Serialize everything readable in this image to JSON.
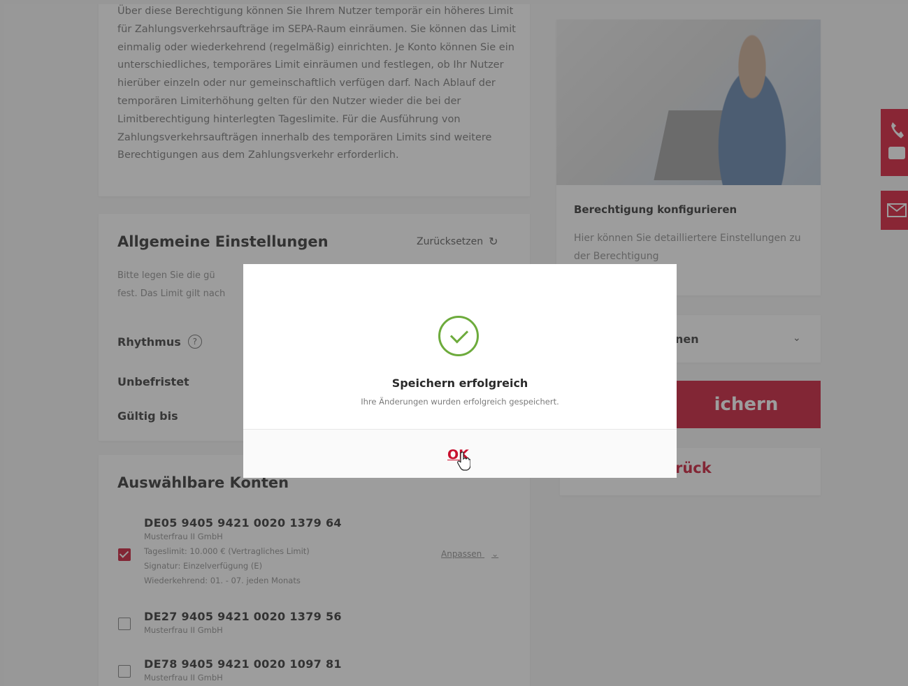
{
  "intro": {
    "text": "Über diese Berechtigung können Sie Ihrem Nutzer temporär ein höheres Limit für Zahlungsverkehrsaufträge im SEPA-Raum einräumen. Sie können das Limit einmalig oder wiederkehrend (regelmäßig) einrichten. Je Konto können Sie ein unterschiedliches, temporäres Limit einräumen und festlegen, ob Ihr Nutzer hierüber einzeln oder nur gemeinschaftlich verfügen darf. Nach Ablauf der temporären Limiterhöhung gelten für den Nutzer wieder die bei der Limitberechtigung hinterlegten Tageslimite. Für die Ausführung von Zahlungsverkehrsaufträgen innerhalb des temporären Limits sind weitere Berechtigungen aus dem Zahlungsverkehr erforderlich."
  },
  "general_settings": {
    "title": "Allgemeine Einstellungen",
    "reset_label": "Zurücksetzen",
    "hint_line1": "Bitte legen Sie die gü",
    "hint_line2": "fest. Das Limit gilt nach",
    "rhythm_label": "Rhythmus",
    "unlimited_label": "Unbefristet",
    "valid_until_label": "Gültig bis"
  },
  "accounts": {
    "title": "Auswählbare Konten",
    "edit_label": "Anpassen",
    "items": [
      {
        "iban": "DE05 9405 9421 0020 1379 64",
        "owner": "Musterfrau II GmbH",
        "limit": "Tageslimit: 10.000 € (Vertragliches Limit)",
        "signature": "Signatur: Einzelverfügung (E)",
        "recurrence": "Wiederkehrend: 01. - 07. jeden Monats",
        "checked": true
      },
      {
        "iban": "DE27 9405 9421 0020 1379 56",
        "owner": "Musterfrau II GmbH",
        "checked": false
      },
      {
        "iban": "DE78 9405 9421 0020 1097 81",
        "owner": "Musterfrau II GmbH",
        "checked": false
      }
    ]
  },
  "sidebar": {
    "card_title": "Berechtigung konfigurieren",
    "card_text": "Hier können Sie detailliertere Einstellungen zu der Berechtigung",
    "row_label": "nen",
    "save_label": "ichern",
    "back_label": "rück"
  },
  "modal": {
    "title": "Speichern erfolgreich",
    "subtitle": "Ihre Änderungen wurden erfolgreich gespeichert.",
    "ok_label": "OK"
  },
  "colors": {
    "brand_red": "#c8102e",
    "success_green": "#6dab3c"
  }
}
